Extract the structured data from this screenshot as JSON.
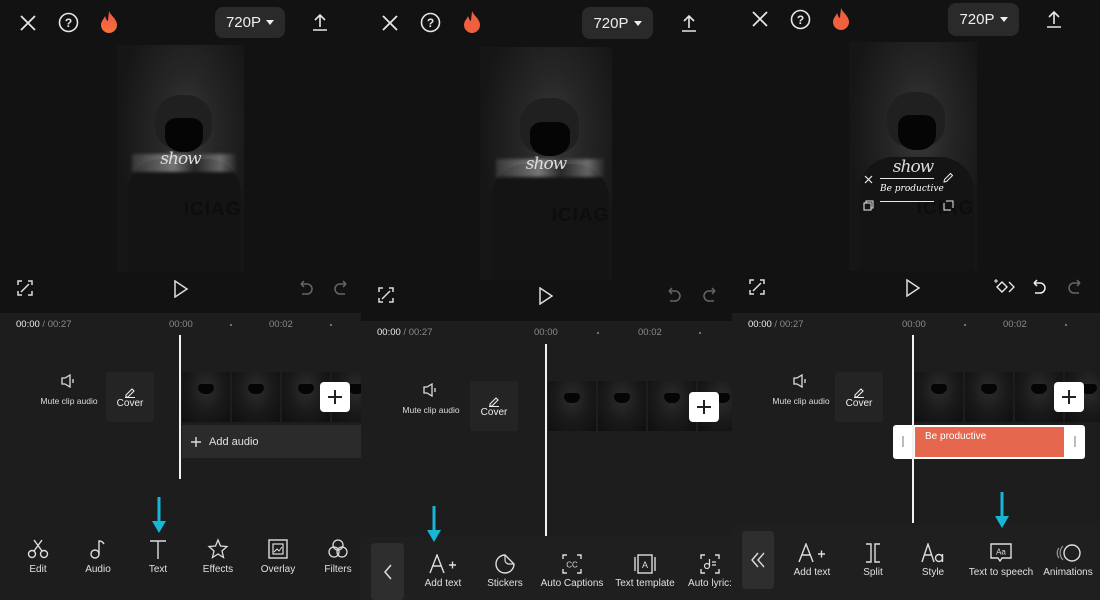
{
  "colors": {
    "background": "#121212",
    "timeline_bg": "#1d1d1d",
    "toolbar_bg": "#1f1f1f",
    "accent_arrow": "#17b5d6",
    "text_track": "#e5674e",
    "fire": "#ef5b3b"
  },
  "panels": [
    {
      "header": {
        "close_icon": "close-icon",
        "help_icon": "help-icon",
        "pro_icon": "fire-icon",
        "resolution": "720P",
        "export_icon": "upload-icon"
      },
      "controls": {
        "fullscreen_icon": "fullscreen-icon",
        "play_icon": "play-icon",
        "undo_icon": "undo-icon",
        "redo_icon": "redo-icon"
      },
      "preview": {
        "overlay_word": "show",
        "brand_text": "ICIAG"
      },
      "timeline": {
        "current_time": "00:00",
        "total_time": "/ 00:27",
        "ruler_ticks": [
          "00:00",
          "00:02"
        ],
        "mute_label": "Mute clip audio",
        "cover_label": "Cover",
        "add_audio_label": "Add audio"
      },
      "toolbar": {
        "items": [
          {
            "label": "Edit",
            "icon": "scissors-icon"
          },
          {
            "label": "Audio",
            "icon": "music-note-icon"
          },
          {
            "label": "Text",
            "icon": "text-icon"
          },
          {
            "label": "Effects",
            "icon": "sparkle-star-icon"
          },
          {
            "label": "Overlay",
            "icon": "overlay-icon"
          },
          {
            "label": "Filters",
            "icon": "filters-icon"
          }
        ],
        "highlighted": "Text"
      }
    },
    {
      "header": {
        "close_icon": "close-icon",
        "help_icon": "help-icon",
        "pro_icon": "fire-icon",
        "resolution": "720P",
        "export_icon": "upload-icon"
      },
      "controls": {
        "fullscreen_icon": "fullscreen-icon",
        "play_icon": "play-icon",
        "undo_icon": "undo-icon",
        "redo_icon": "redo-icon"
      },
      "preview": {
        "overlay_word": "show",
        "brand_text": "ICIAG"
      },
      "timeline": {
        "current_time": "00:00",
        "total_time": "/ 00:27",
        "ruler_ticks": [
          "00:00",
          "00:02"
        ],
        "mute_label": "Mute clip audio",
        "cover_label": "Cover"
      },
      "toolbar": {
        "back_icon": "chevron-left-icon",
        "items": [
          {
            "label": "Add text",
            "icon": "add-text-icon"
          },
          {
            "label": "Stickers",
            "icon": "sticker-icon"
          },
          {
            "label": "Auto Captions",
            "icon": "captions-icon"
          },
          {
            "label": "Text template",
            "icon": "text-template-icon"
          },
          {
            "label": "Auto lyric:",
            "icon": "auto-lyrics-icon"
          }
        ],
        "highlighted": "Add text"
      }
    },
    {
      "header": {
        "close_icon": "close-icon",
        "help_icon": "help-icon",
        "pro_icon": "fire-icon",
        "resolution": "720P",
        "export_icon": "upload-icon"
      },
      "controls": {
        "fullscreen_icon": "fullscreen-icon",
        "play_icon": "play-icon",
        "keyframe_icon": "keyframe-icon",
        "undo_icon": "undo-icon",
        "redo_icon": "redo-icon"
      },
      "preview": {
        "overlay_word": "show",
        "brand_text": "ICIAG",
        "text_overlay": "Be productive"
      },
      "timeline": {
        "current_time": "00:00",
        "total_time": "/ 00:27",
        "ruler_ticks": [
          "00:00",
          "00:02"
        ],
        "mute_label": "Mute clip audio",
        "cover_label": "Cover",
        "text_track_label": "Be productive"
      },
      "toolbar": {
        "back_icon": "double-chevron-left-icon",
        "items": [
          {
            "label": "Add text",
            "icon": "add-text-icon"
          },
          {
            "label": "Split",
            "icon": "split-icon"
          },
          {
            "label": "Style",
            "icon": "style-icon"
          },
          {
            "label": "Text to speech",
            "icon": "text-to-speech-icon"
          },
          {
            "label": "Animations",
            "icon": "animations-icon"
          }
        ],
        "highlighted": "Text to speech"
      }
    }
  ]
}
